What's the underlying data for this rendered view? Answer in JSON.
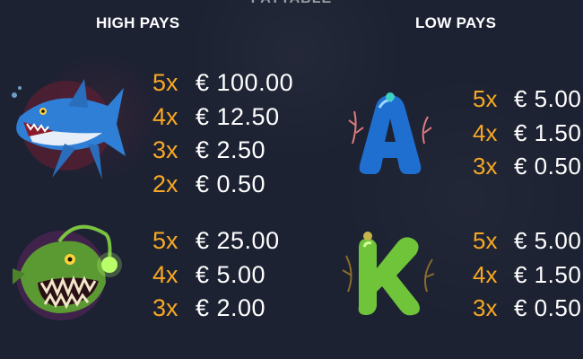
{
  "header": {
    "partial_title": "PAYTABLE"
  },
  "sections": {
    "high": {
      "title": "HIGH PAYS"
    },
    "low": {
      "title": "LOW PAYS"
    }
  },
  "symbols": {
    "shark": {
      "icon": "shark-icon",
      "pays": [
        {
          "mult": "5x",
          "amount": "€ 100.00"
        },
        {
          "mult": "4x",
          "amount": "€ 12.50"
        },
        {
          "mult": "3x",
          "amount": "€ 2.50"
        },
        {
          "mult": "2x",
          "amount": "€ 0.50"
        }
      ]
    },
    "angler": {
      "icon": "anglerfish-icon",
      "pays": [
        {
          "mult": "5x",
          "amount": "€ 25.00"
        },
        {
          "mult": "4x",
          "amount": "€ 5.00"
        },
        {
          "mult": "3x",
          "amount": "€ 2.00"
        }
      ]
    },
    "letter_a": {
      "icon": "letter-a-icon",
      "pays": [
        {
          "mult": "5x",
          "amount": "€ 5.00"
        },
        {
          "mult": "4x",
          "amount": "€ 1.50"
        },
        {
          "mult": "3x",
          "amount": "€ 0.50"
        }
      ]
    },
    "letter_k": {
      "icon": "letter-k-icon",
      "pays": [
        {
          "mult": "5x",
          "amount": "€ 5.00"
        },
        {
          "mult": "4x",
          "amount": "€ 1.50"
        },
        {
          "mult": "3x",
          "amount": "€ 0.50"
        }
      ]
    }
  },
  "colors": {
    "background": "#1d2233",
    "multiplier": "#f7a823",
    "amount": "#ffffff"
  }
}
